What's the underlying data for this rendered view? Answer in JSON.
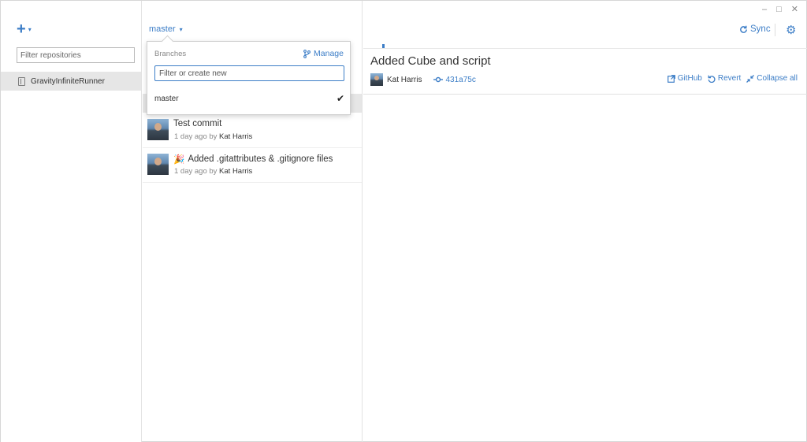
{
  "window": {
    "controls": {
      "minimize": "–",
      "maximize": "□",
      "close": "✕"
    }
  },
  "sidebar": {
    "add_icon": "+",
    "add_caret": "▾",
    "filter_placeholder": "Filter repositories",
    "repos": [
      {
        "name": "GravityInfiniteRunner"
      }
    ]
  },
  "branch": {
    "current": "master",
    "caret": "▾",
    "dropdown": {
      "title": "Branches",
      "manage_label": "Manage",
      "filter_placeholder": "Filter or create new",
      "items": [
        {
          "name": "master",
          "checked": true
        }
      ]
    }
  },
  "commits": [
    {
      "message": "Test commit",
      "time": "1 day ago by",
      "author": "Kat Harris",
      "emoji": ""
    },
    {
      "message": "Added .gitattributes & .gitignore files",
      "time": "1 day ago by",
      "author": "Kat Harris",
      "emoji": "🎉"
    }
  ],
  "toolbar": {
    "sync_label": "Sync"
  },
  "detail": {
    "title": "Added Cube and script",
    "author": "Kat Harris",
    "sha": "431a75c",
    "actions": {
      "github": "GitHub",
      "revert": "Revert",
      "collapse": "Collapse all"
    }
  },
  "colors": {
    "accent": "#3d7ec7",
    "selected_row": "#e6e6e6"
  }
}
